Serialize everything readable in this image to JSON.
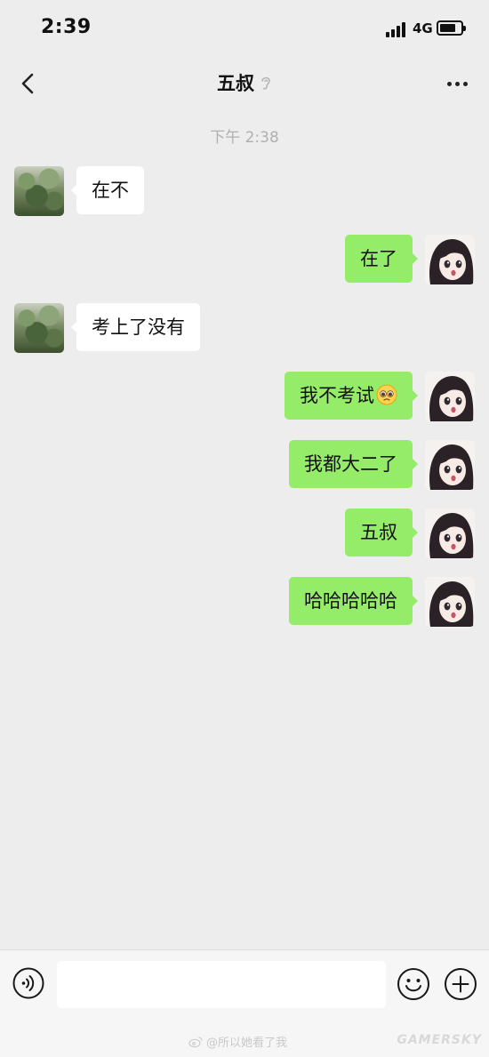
{
  "status_bar": {
    "time": "2:39",
    "network": "4G"
  },
  "nav": {
    "title": "五叔",
    "back_icon": "chevron-left-icon",
    "more_icon": "ellipsis-icon",
    "mute_icon": "ear-icon"
  },
  "chat": {
    "timestamp": "下午 2:38",
    "messages": [
      {
        "side": "in",
        "text": "在不"
      },
      {
        "side": "out",
        "text": "在了"
      },
      {
        "side": "in",
        "text": "考上了没有"
      },
      {
        "side": "out",
        "text": "我不考试",
        "emoji": "pleading-face"
      },
      {
        "side": "out",
        "text": "我都大二了"
      },
      {
        "side": "out",
        "text": "五叔"
      },
      {
        "side": "out",
        "text": "哈哈哈哈哈"
      }
    ]
  },
  "input_bar": {
    "value": "",
    "voice_icon": "voice-icon",
    "emoji_icon": "smiley-icon",
    "plus_icon": "plus-icon"
  },
  "watermark": {
    "weibo": "@所以她看了我",
    "site": "GAMERSKY"
  },
  "colors": {
    "background": "#ededed",
    "outgoing_bubble": "#95ec69",
    "incoming_bubble": "#ffffff",
    "timestamp": "#b0b0b0"
  }
}
